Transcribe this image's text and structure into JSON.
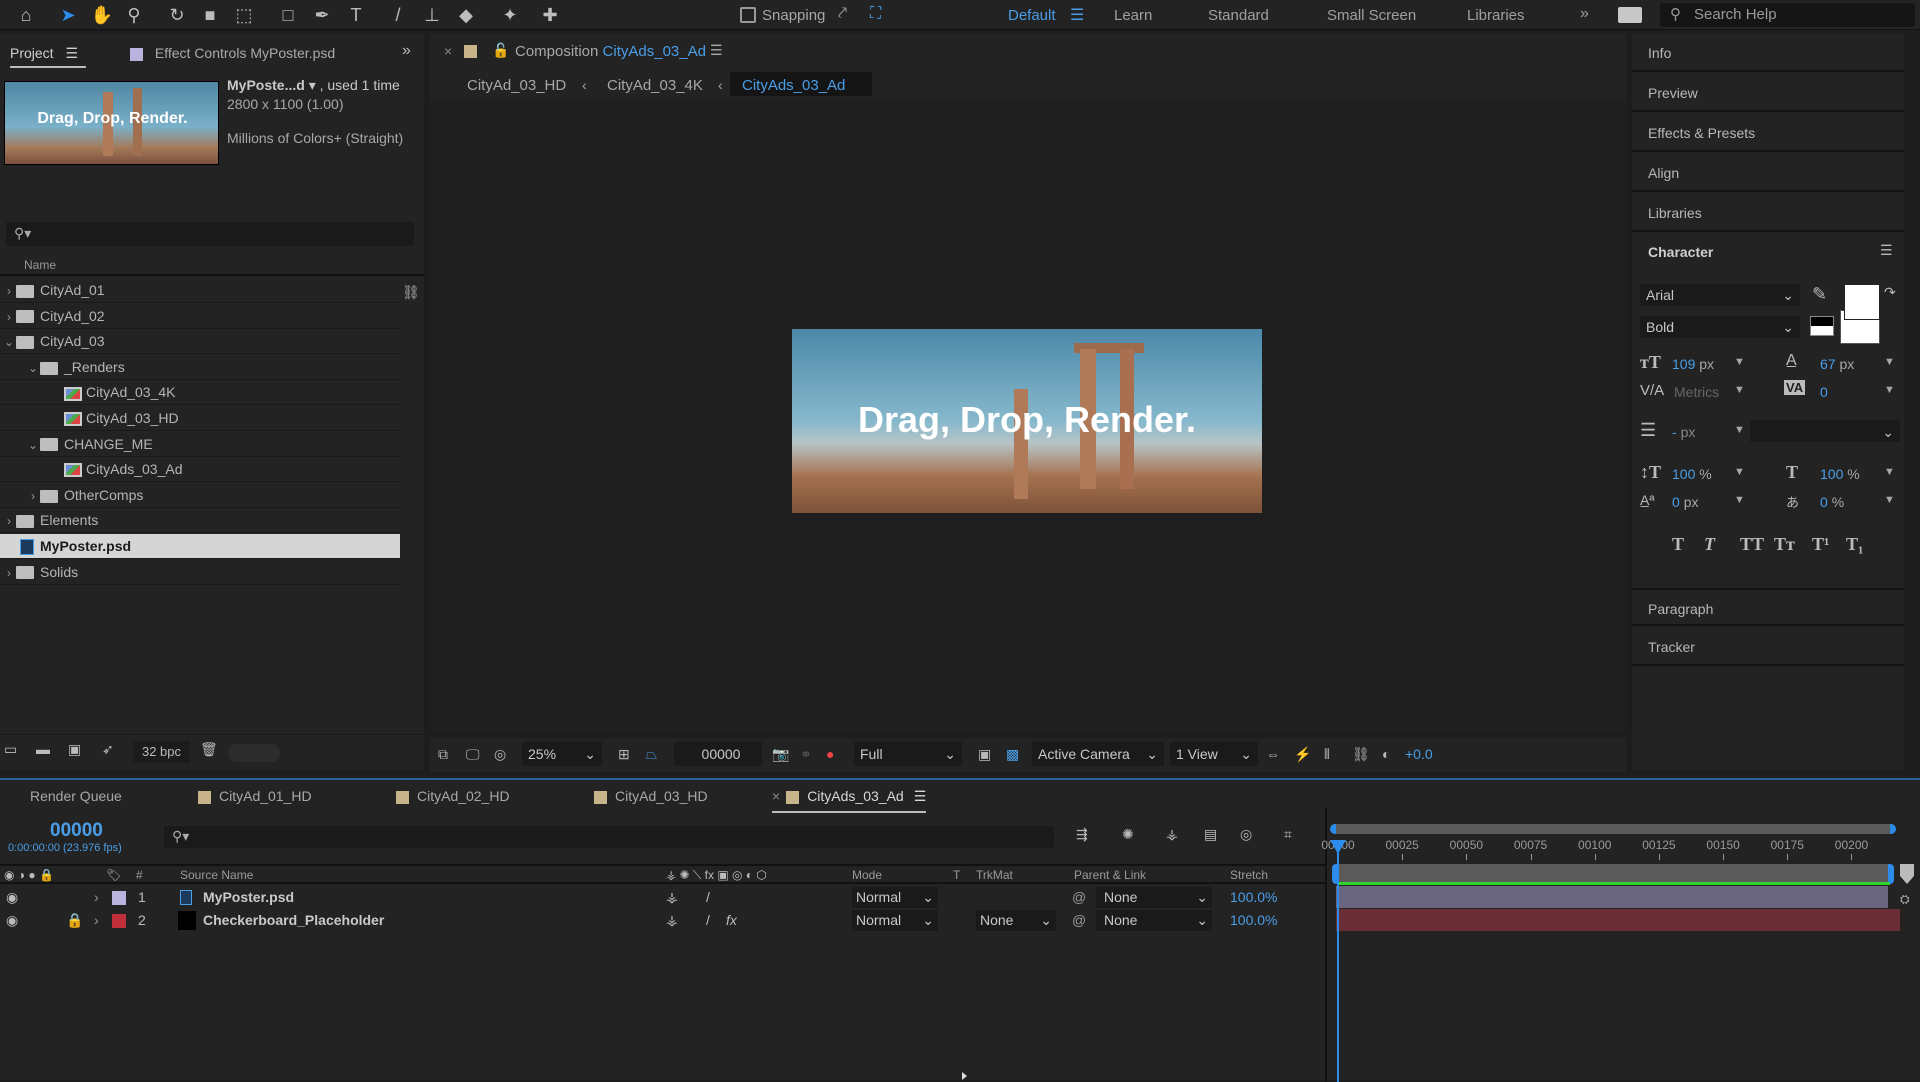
{
  "toolbar": {
    "tools": [
      "home-icon",
      "selection-icon",
      "hand-icon",
      "zoom-icon",
      "rotate-icon",
      "camera-icon",
      "pan-behind-icon",
      "rectangle-icon",
      "pen-icon",
      "type-icon",
      "brush-icon",
      "clone-stamp-icon",
      "eraser-icon",
      "roto-brush-icon",
      "puppet-pin-icon"
    ],
    "snapping_label": "Snapping",
    "workspaces": [
      "Default",
      "Learn",
      "Standard",
      "Small Screen",
      "Libraries"
    ],
    "active_workspace": "Default",
    "search_placeholder": "Search Help"
  },
  "project_panel": {
    "tab_label": "Project",
    "effect_controls_tab": "Effect Controls MyPoster.psd",
    "thumbnail_text": "Drag, Drop, Render.",
    "asset_name": "MyPoste...d",
    "asset_usage": ", used 1 time",
    "asset_dims": "2800 x 1100 (1.00)",
    "asset_colors": "Millions of Colors+ (Straight)",
    "column_name": "Name",
    "items": [
      {
        "label": "CityAd_01",
        "type": "folder",
        "depth": 0,
        "expanded": false
      },
      {
        "label": "CityAd_02",
        "type": "folder",
        "depth": 0,
        "expanded": false
      },
      {
        "label": "CityAd_03",
        "type": "folder",
        "depth": 0,
        "expanded": true
      },
      {
        "label": "_Renders",
        "type": "folder",
        "depth": 1,
        "expanded": true
      },
      {
        "label": "CityAd_03_4K",
        "type": "comp",
        "depth": 2
      },
      {
        "label": "CityAd_03_HD",
        "type": "comp",
        "depth": 2
      },
      {
        "label": "CHANGE_ME",
        "type": "folder",
        "depth": 1,
        "expanded": true
      },
      {
        "label": "CityAds_03_Ad",
        "type": "comp",
        "depth": 2
      },
      {
        "label": "OtherComps",
        "type": "folder",
        "depth": 1,
        "expanded": false
      },
      {
        "label": "Elements",
        "type": "folder",
        "depth": 0,
        "expanded": false
      },
      {
        "label": "MyPoster.psd",
        "type": "psd",
        "depth": 0,
        "selected": true
      },
      {
        "label": "Solids",
        "type": "folder",
        "depth": 0,
        "expanded": false
      }
    ],
    "bpc_label": "32 bpc"
  },
  "composition": {
    "tab_prefix": "Composition",
    "tab_name": "CityAds_03_Ad",
    "breadcrumbs": [
      "CityAd_03_HD",
      "CityAd_03_4K",
      "CityAds_03_Ad"
    ],
    "canvas_text": "Drag, Drop, Render.",
    "zoom": "25%",
    "timecode": "00000",
    "resolution": "Full",
    "camera": "Active Camera",
    "views": "1 View",
    "exposure": "+0.0"
  },
  "right_panel": {
    "items": [
      "Info",
      "Preview",
      "Effects & Presets",
      "Align",
      "Libraries"
    ],
    "character_title": "Character",
    "font_family": "Arial",
    "font_style": "Bold",
    "font_size": "109",
    "leading": "67",
    "kerning": "Metrics",
    "tracking": "0",
    "stroke_width": "-",
    "vertical_scale": "100",
    "horizontal_scale": "100",
    "baseline_shift": "0",
    "tsume": "0",
    "unit_px": "px",
    "unit_pct": "%",
    "style_buttons": [
      "T",
      "T",
      "TT",
      "Tт",
      "T¹",
      "T₁"
    ],
    "paragraph": "Paragraph",
    "tracker": "Tracker",
    "fill_color": "#ffffff",
    "stroke_color": "#000000"
  },
  "timeline": {
    "tabs": [
      "Render Queue",
      "CityAd_01_HD",
      "CityAd_02_HD",
      "CityAd_03_HD",
      "CityAds_03_Ad"
    ],
    "active_tab": "CityAds_03_Ad",
    "timecode": "00000",
    "timecode_sub": "0:00:00:00 (23.976 fps)",
    "columns": {
      "source": "Source Name",
      "mode": "Mode",
      "t": "T",
      "trkmat": "TrkMat",
      "parent": "Parent & Link",
      "stretch": "Stretch"
    },
    "ruler": [
      "00000",
      "00025",
      "00050",
      "00075",
      "00100",
      "00125",
      "00150",
      "00175",
      "00200"
    ],
    "layers": [
      {
        "num": "1",
        "name": "MyPoster.psd",
        "color": "#b9b3de",
        "mode": "Normal",
        "trkmat": "",
        "parent": "None",
        "stretch": "100.0%",
        "locked": false,
        "bar_color": "#6b6680"
      },
      {
        "num": "2",
        "name": "Checkerboard_Placeholder",
        "color": "#c0303a",
        "mode": "Normal",
        "trkmat": "None",
        "parent": "None",
        "stretch": "100.0%",
        "locked": true,
        "bar_color": "#6b2d36"
      }
    ]
  }
}
